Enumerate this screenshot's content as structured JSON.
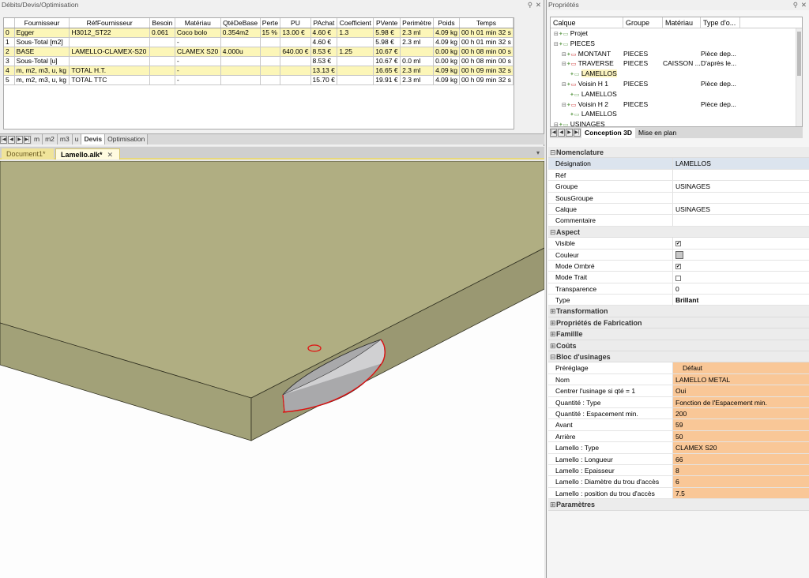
{
  "devis": {
    "title": "Débits/Devis/Optimisation",
    "columns": [
      "",
      "Fournisseur",
      "RéfFournisseur",
      "Besoin",
      "Matériau",
      "QtéDeBase",
      "Perte",
      "PU",
      "PAchat",
      "Coefficient",
      "PVente",
      "Perimètre",
      "Poids",
      "Temps"
    ],
    "rows": [
      [
        "0",
        "Egger",
        "H3012_ST22",
        "0.061",
        "Coco bolo",
        "0.354m2",
        "15 %",
        "13.00 €",
        "4.60 €",
        "1.3",
        "5.98 €",
        "2.3 ml",
        "4.09 kg",
        "00 h 01 min 32 s"
      ],
      [
        "1",
        "Sous-Total [m2]",
        "",
        "",
        "-",
        "",
        "",
        "",
        "4.60 €",
        "",
        "5.98 €",
        "2.3 ml",
        "4.09 kg",
        "00 h 01 min 32 s"
      ],
      [
        "2",
        "BASE",
        "LAMELLO-CLAMEX-S20",
        "",
        "CLAMEX S20",
        "4.000u",
        "",
        "640.00 €",
        "8.53 €",
        "1.25",
        "10.67 €",
        "",
        "0.00 kg",
        "00 h 08 min 00 s"
      ],
      [
        "3",
        "Sous-Total [u]",
        "",
        "",
        "-",
        "",
        "",
        "",
        "8.53 €",
        "",
        "10.67 €",
        "0.0 ml",
        "0.00 kg",
        "00 h 08 min 00 s"
      ],
      [
        "4",
        "m, m2, m3, u, kg",
        "TOTAL H.T.",
        "",
        "-",
        "",
        "",
        "",
        "13.13 €",
        "",
        "16.65 €",
        "2.3 ml",
        "4.09 kg",
        "00 h 09 min 32 s"
      ],
      [
        "5",
        "m, m2, m3, u, kg",
        "TOTAL TTC",
        "",
        "-",
        "",
        "",
        "",
        "15.70 €",
        "",
        "19.91 €",
        "2.3 ml",
        "4.09 kg",
        "00 h 09 min 32 s"
      ]
    ],
    "tabs": [
      "m",
      "m2",
      "m3",
      "u",
      "Devis",
      "Optimisation"
    ],
    "active_tab": "Devis"
  },
  "documents": {
    "tabs": [
      "Document1*",
      "Lamello.alk*"
    ],
    "active": "Lamello.alk*"
  },
  "props": {
    "title": "Propriétés",
    "tree_columns": [
      "Calque",
      "Groupe",
      "Matériau",
      "Type d'o..."
    ],
    "tree_rows": [
      {
        "indent": 0,
        "label": "Projet",
        "groupe": "",
        "materiau": "",
        "type": ""
      },
      {
        "indent": 0,
        "label": "PIECES",
        "groupe": "",
        "materiau": "",
        "type": ""
      },
      {
        "indent": 1,
        "label": "MONTANT",
        "groupe": "PIECES",
        "materiau": "",
        "type": "Pièce dep..."
      },
      {
        "indent": 1,
        "label": "TRAVERSE",
        "groupe": "PIECES",
        "materiau": "CAISSON ...",
        "type": "D'après le..."
      },
      {
        "indent": 2,
        "label": "LAMELLOS",
        "groupe": "",
        "materiau": "",
        "type": ""
      },
      {
        "indent": 1,
        "label": "Voisin H 1",
        "groupe": "PIECES",
        "materiau": "",
        "type": "Pièce dep..."
      },
      {
        "indent": 2,
        "label": "LAMELLOS",
        "groupe": "",
        "materiau": "",
        "type": ""
      },
      {
        "indent": 1,
        "label": "Voisin H 2",
        "groupe": "PIECES",
        "materiau": "",
        "type": "Pièce dep..."
      },
      {
        "indent": 2,
        "label": "LAMELLOS",
        "groupe": "",
        "materiau": "",
        "type": ""
      },
      {
        "indent": 0,
        "label": "USINAGES",
        "groupe": "",
        "materiau": "",
        "type": ""
      }
    ],
    "tabs": [
      "Conception 3D",
      "Mise en plan"
    ],
    "sections": {
      "nomenclature": {
        "title": "Nomenclature",
        "rows": [
          {
            "k": "Désignation",
            "v": "LAMELLOS"
          },
          {
            "k": "Réf",
            "v": ""
          },
          {
            "k": "Groupe",
            "v": "USINAGES"
          },
          {
            "k": "SousGroupe",
            "v": ""
          },
          {
            "k": "Calque",
            "v": "USINAGES"
          },
          {
            "k": "Commentaire",
            "v": ""
          }
        ]
      },
      "aspect": {
        "title": "Aspect",
        "visible_label": "Visible",
        "couleur_label": "Couleur",
        "ombre_label": "Mode Ombré",
        "trait_label": "Mode Trait",
        "transp_label": "Transparence",
        "transp_value": "0",
        "type_label": "Type",
        "type_value": "Brillant"
      },
      "transformation": "Transformation",
      "fabrication": "Propriétés de Fabrication",
      "famille": "Famillle",
      "couts": "Coûts",
      "bloc": {
        "title": "Bloc d'usinages",
        "rows": [
          {
            "k": "Préréglage",
            "v": "Défaut"
          },
          {
            "k": "Nom",
            "v": "LAMELLO METAL"
          },
          {
            "k": "Centrer l'usinage si qté = 1",
            "v": "Oui"
          },
          {
            "k": "Quantité : Type",
            "v": "Fonction de l'Espacement min."
          },
          {
            "k": "Quantité : Espacement min.",
            "v": "200"
          },
          {
            "k": "Avant",
            "v": "59"
          },
          {
            "k": "Arrière",
            "v": "50"
          },
          {
            "k": "Lamello : Type",
            "v": "CLAMEX S20"
          },
          {
            "k": "Lamello : Longueur",
            "v": "66"
          },
          {
            "k": "Lamello : Epaisseur",
            "v": "8"
          },
          {
            "k": "Lamello : Diamètre du trou d'accès",
            "v": "6"
          },
          {
            "k": "Lamello : position du trou d'accès",
            "v": "7.5"
          }
        ]
      },
      "parametres": "Paramètres"
    }
  }
}
